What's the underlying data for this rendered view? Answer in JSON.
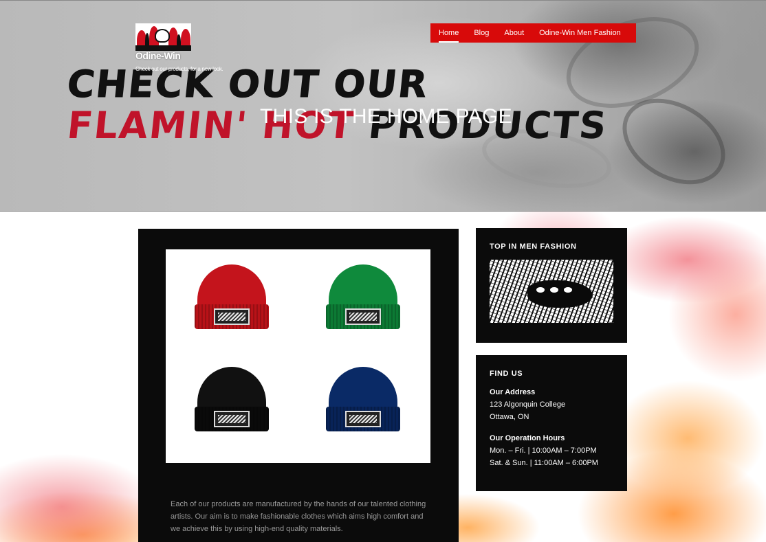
{
  "site": {
    "title": "Odine-Win",
    "tagline": "Check out our products, for a new look."
  },
  "hero": {
    "graffiti_line1": "CHECK OUT OUR",
    "graffiti_line2_red": "FLAMIN' HOT",
    "graffiti_line2_black": " PRODUCTS",
    "page_title": "THIS IS THE HOME PAGE"
  },
  "nav": {
    "items": [
      "Home",
      "Blog",
      "About",
      "Odine-Win Men Fashion"
    ],
    "active": "Home"
  },
  "main": {
    "products": [
      {
        "name": "red-beanie",
        "color": "#c4141c"
      },
      {
        "name": "green-beanie",
        "color": "#0f8a3c"
      },
      {
        "name": "black-beanie",
        "color": "#111111"
      },
      {
        "name": "navy-beanie",
        "color": "#0a2a66"
      }
    ],
    "description": "Each of our products are manufactured by the hands of our talented clothing artists. Our aim is to make fashionable clothes which aims high comfort and we achieve this by using high-end quality materials."
  },
  "sidebar": {
    "top_widget_title": "TOP IN MEN FASHION",
    "find_us": {
      "title": "FIND US",
      "address_label": "Our Address",
      "address_line1": "123 Algonquin College",
      "address_line2": "Ottawa, ON",
      "hours_label": "Our Operation Hours",
      "hours_line1": "Mon. – Fri. | 10:00AM – 7:00PM",
      "hours_line2": "Sat. & Sun. | 11:00AM – 6:00PM"
    }
  },
  "colors": {
    "nav_bg": "#d80a0a",
    "card_bg": "#0b0b0b",
    "accent_red": "#c0132a"
  }
}
